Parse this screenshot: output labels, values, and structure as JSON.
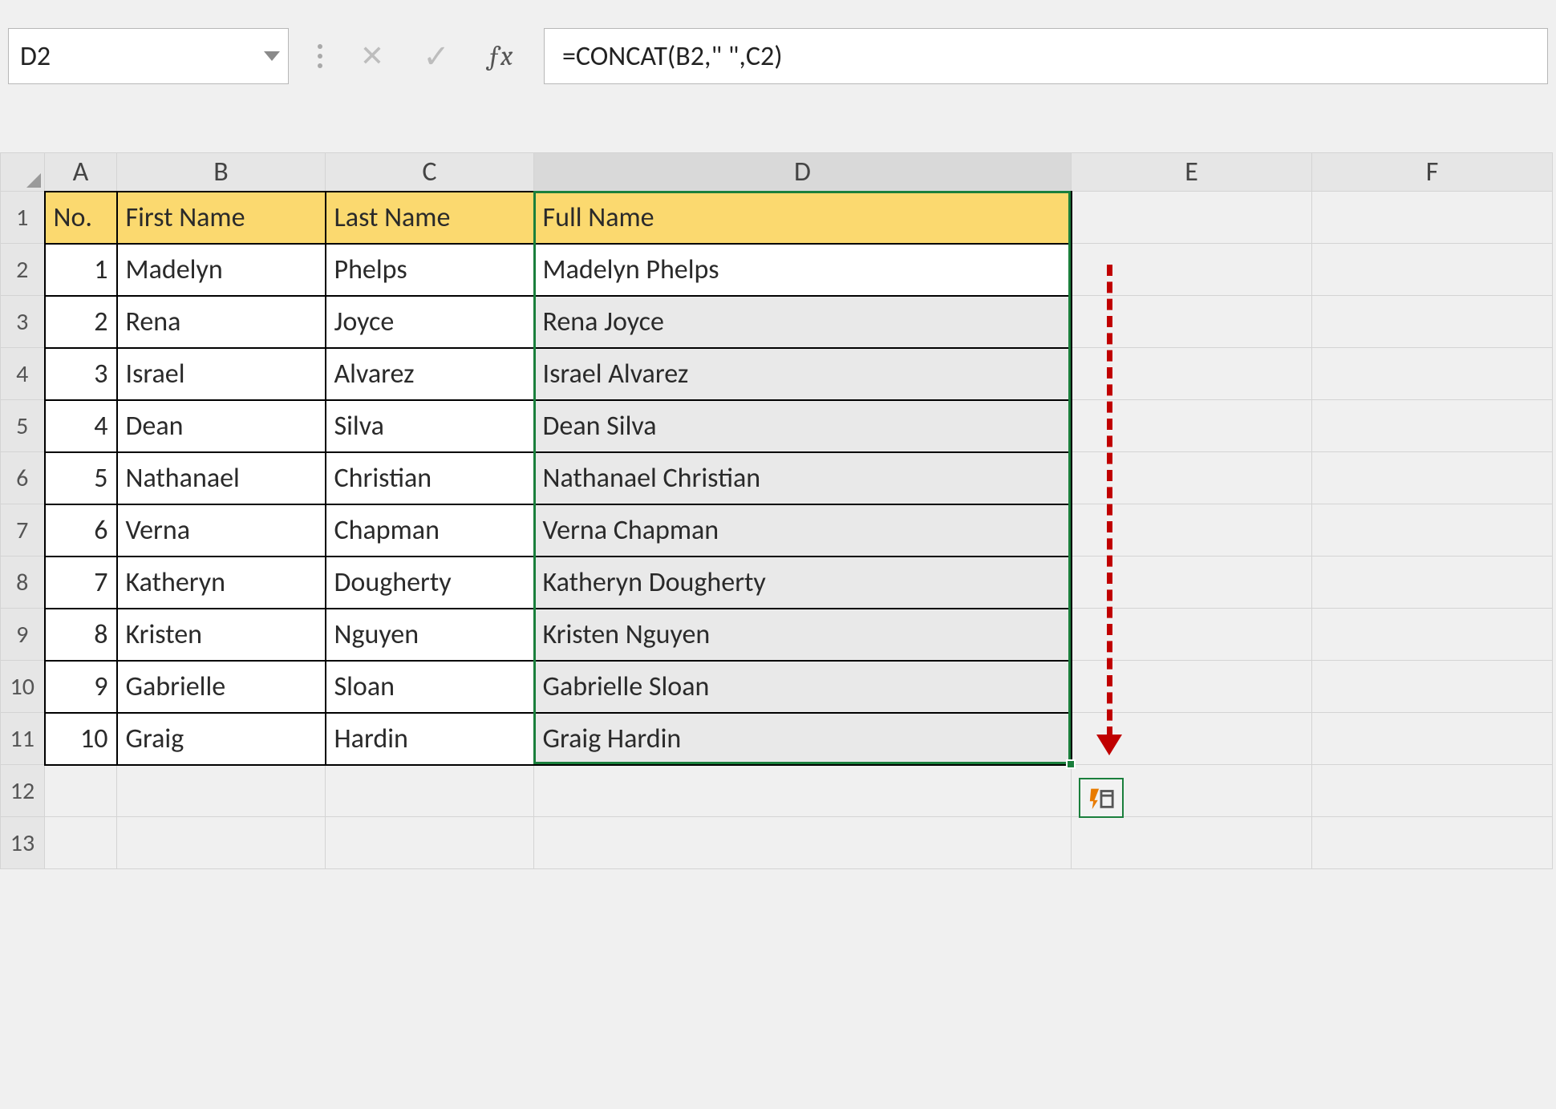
{
  "name_box": {
    "value": "D2"
  },
  "formula_bar": {
    "value": "=CONCAT(B2,\" \",C2)"
  },
  "fx_label": "ƒx",
  "columns": [
    "A",
    "B",
    "C",
    "D",
    "E",
    "F"
  ],
  "row_numbers": [
    "1",
    "2",
    "3",
    "4",
    "5",
    "6",
    "7",
    "8",
    "9",
    "10",
    "11",
    "12",
    "13"
  ],
  "headers": {
    "A": "No.",
    "B": "First Name",
    "C": "Last Name",
    "D": "Full Name"
  },
  "rows": [
    {
      "no": "1",
      "first": "Madelyn",
      "last": "Phelps",
      "full": "Madelyn Phelps"
    },
    {
      "no": "2",
      "first": "Rena",
      "last": "Joyce",
      "full": "Rena Joyce"
    },
    {
      "no": "3",
      "first": "Israel",
      "last": "Alvarez",
      "full": "Israel Alvarez"
    },
    {
      "no": "4",
      "first": "Dean",
      "last": "Silva",
      "full": "Dean Silva"
    },
    {
      "no": "5",
      "first": "Nathanael",
      "last": "Christian",
      "full": "Nathanael Christian"
    },
    {
      "no": "6",
      "first": "Verna",
      "last": "Chapman",
      "full": "Verna Chapman"
    },
    {
      "no": "7",
      "first": "Katheryn",
      "last": "Dougherty",
      "full": "Katheryn Dougherty"
    },
    {
      "no": "8",
      "first": "Kristen",
      "last": "Nguyen",
      "full": "Kristen Nguyen"
    },
    {
      "no": "9",
      "first": "Gabrielle",
      "last": "Sloan",
      "full": "Gabrielle Sloan"
    },
    {
      "no": "10",
      "first": "Graig",
      "last": "Hardin",
      "full": "Graig Hardin"
    }
  ]
}
